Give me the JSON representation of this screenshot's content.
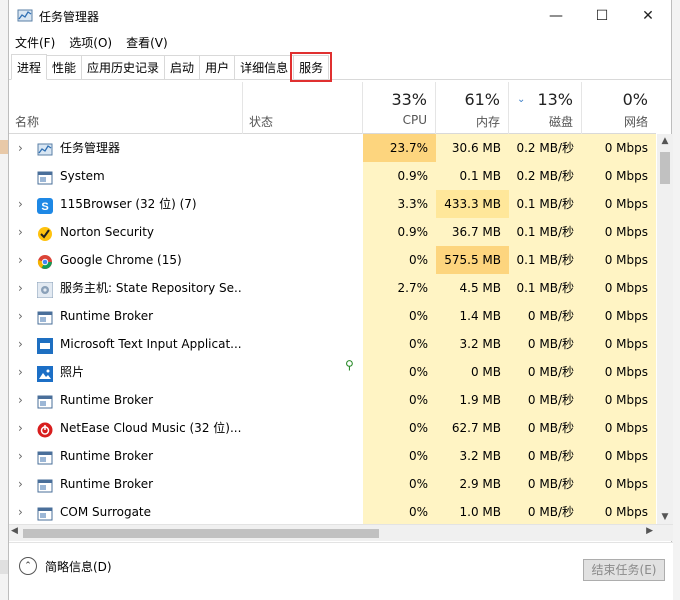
{
  "window": {
    "title": "任务管理器"
  },
  "menu": [
    "文件(F)",
    "选项(O)",
    "查看(V)"
  ],
  "tabs": [
    "进程",
    "性能",
    "应用历史记录",
    "启动",
    "用户",
    "详细信息",
    "服务"
  ],
  "active_tab": "进程",
  "highlighted_tab": "服务",
  "columns": {
    "name": "名称",
    "status": "状态",
    "cpu": {
      "pct": "33%",
      "label": "CPU"
    },
    "mem": {
      "pct": "61%",
      "label": "内存"
    },
    "disk": {
      "pct": "13%",
      "label": "磁盘"
    },
    "net": {
      "pct": "0%",
      "label": "网络"
    }
  },
  "rows": [
    {
      "name": "任务管理器",
      "icon": "taskmgr-icon",
      "expand": true,
      "cpu": "23.7%",
      "mem": "30.6 MB",
      "disk": "0.2 MB/秒",
      "net": "0 Mbps",
      "cpu_heat": "high",
      "mem_heat": "low"
    },
    {
      "name": "System",
      "icon": "system-icon",
      "expand": false,
      "cpu": "0.9%",
      "mem": "0.1 MB",
      "disk": "0.2 MB/秒",
      "net": "0 Mbps",
      "cpu_heat": "low",
      "mem_heat": "low"
    },
    {
      "name": "115Browser (32 位) (7)",
      "icon": "115browser-icon",
      "expand": true,
      "cpu": "3.3%",
      "mem": "433.3 MB",
      "disk": "0.1 MB/秒",
      "net": "0 Mbps",
      "cpu_heat": "low",
      "mem_heat": "mid"
    },
    {
      "name": "Norton Security",
      "icon": "norton-icon",
      "expand": true,
      "cpu": "0.9%",
      "mem": "36.7 MB",
      "disk": "0.1 MB/秒",
      "net": "0 Mbps",
      "cpu_heat": "low",
      "mem_heat": "low"
    },
    {
      "name": "Google Chrome (15)",
      "icon": "chrome-icon",
      "expand": true,
      "cpu": "0%",
      "mem": "575.5 MB",
      "disk": "0.1 MB/秒",
      "net": "0 Mbps",
      "cpu_heat": "low",
      "mem_heat": "high"
    },
    {
      "name": "服务主机: State Repository Se...",
      "icon": "gear-icon",
      "expand": true,
      "cpu": "2.7%",
      "mem": "4.5 MB",
      "disk": "0.1 MB/秒",
      "net": "0 Mbps",
      "cpu_heat": "low",
      "mem_heat": "low"
    },
    {
      "name": "Runtime Broker",
      "icon": "window-icon",
      "expand": true,
      "cpu": "0%",
      "mem": "1.4 MB",
      "disk": "0 MB/秒",
      "net": "0 Mbps",
      "cpu_heat": "low",
      "mem_heat": "low"
    },
    {
      "name": "Microsoft Text Input Applicat...",
      "icon": "text-input-icon",
      "expand": true,
      "cpu": "0%",
      "mem": "3.2 MB",
      "disk": "0 MB/秒",
      "net": "0 Mbps",
      "cpu_heat": "low",
      "mem_heat": "low"
    },
    {
      "name": "照片",
      "icon": "photos-icon",
      "expand": true,
      "status_icon": "leaf-icon",
      "cpu": "0%",
      "mem": "0 MB",
      "disk": "0 MB/秒",
      "net": "0 Mbps",
      "cpu_heat": "low",
      "mem_heat": "low"
    },
    {
      "name": "Runtime Broker",
      "icon": "window-icon",
      "expand": true,
      "cpu": "0%",
      "mem": "1.9 MB",
      "disk": "0 MB/秒",
      "net": "0 Mbps",
      "cpu_heat": "low",
      "mem_heat": "low"
    },
    {
      "name": "NetEase Cloud Music (32 位)...",
      "icon": "netease-icon",
      "expand": true,
      "cpu": "0%",
      "mem": "62.7 MB",
      "disk": "0 MB/秒",
      "net": "0 Mbps",
      "cpu_heat": "low",
      "mem_heat": "low"
    },
    {
      "name": "Runtime Broker",
      "icon": "window-icon",
      "expand": true,
      "cpu": "0%",
      "mem": "3.2 MB",
      "disk": "0 MB/秒",
      "net": "0 Mbps",
      "cpu_heat": "low",
      "mem_heat": "low"
    },
    {
      "name": "Runtime Broker",
      "icon": "window-icon",
      "expand": true,
      "cpu": "0%",
      "mem": "2.9 MB",
      "disk": "0 MB/秒",
      "net": "0 Mbps",
      "cpu_heat": "low",
      "mem_heat": "low"
    },
    {
      "name": "COM Surrogate",
      "icon": "window-icon",
      "expand": true,
      "cpu": "0%",
      "mem": "1.0 MB",
      "disk": "0 MB/秒",
      "net": "0 Mbps",
      "cpu_heat": "low",
      "mem_heat": "low"
    }
  ],
  "footer": {
    "fewer_details": "简略信息(D)",
    "end_task": "结束任务(E)"
  },
  "colors": {
    "heat_low": "#fff4c4",
    "heat_mid": "#ffe79a",
    "heat_high": "#fdd57e",
    "highlight": "#e03030"
  }
}
